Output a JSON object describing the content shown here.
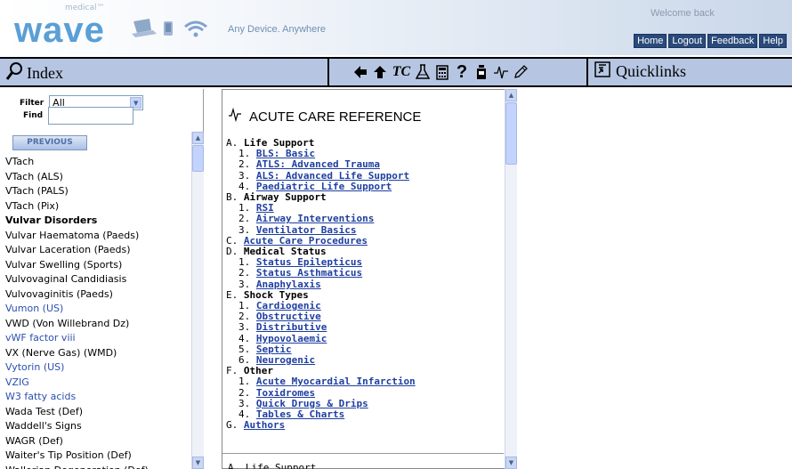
{
  "header": {
    "logo_small": "medical™",
    "logo": "wave",
    "tagline": "Any Device. Anywhere",
    "welcome": "Welcome back",
    "links": [
      "Home",
      "Logout",
      "Feedback",
      "Help"
    ]
  },
  "toolbar": {
    "index_label": "Index",
    "quicklinks_label": "Quicklinks",
    "tool_text": "TC",
    "icons": [
      "arrow-left-icon",
      "arrow-up-icon",
      "tc-icon",
      "flask-icon",
      "calculator-icon",
      "help-icon",
      "drug-icon",
      "ecg-icon",
      "pencil-icon"
    ]
  },
  "left": {
    "filter_label": "Filter",
    "filter_value": "All",
    "find_label": "Find",
    "find_value": "",
    "previous": "PREVIOUS",
    "items": [
      {
        "text": "VTach",
        "style": ""
      },
      {
        "text": "VTach (ALS)",
        "style": ""
      },
      {
        "text": "VTach (PALS)",
        "style": ""
      },
      {
        "text": "VTach (Pix)",
        "style": ""
      },
      {
        "text": "Vulvar Disorders",
        "style": "bold"
      },
      {
        "text": "Vulvar Haematoma (Paeds)",
        "style": ""
      },
      {
        "text": "Vulvar Laceration (Paeds)",
        "style": ""
      },
      {
        "text": "Vulvar Swelling (Sports)",
        "style": ""
      },
      {
        "text": "Vulvovaginal Candidiasis",
        "style": ""
      },
      {
        "text": "Vulvovaginitis (Paeds)",
        "style": ""
      },
      {
        "text": "Vumon (US)",
        "style": "blue"
      },
      {
        "text": "VWD (Von Willebrand Dz)",
        "style": ""
      },
      {
        "text": "vWF factor viii",
        "style": "blue"
      },
      {
        "text": "VX (Nerve Gas) (WMD)",
        "style": ""
      },
      {
        "text": "Vytorin (US)",
        "style": "blue"
      },
      {
        "text": "VZIG",
        "style": "blue"
      },
      {
        "text": "W3 fatty acids",
        "style": "blue"
      },
      {
        "text": "Wada Test (Def)",
        "style": ""
      },
      {
        "text": "Waddell's Signs",
        "style": ""
      },
      {
        "text": "WAGR (Def)",
        "style": ""
      },
      {
        "text": "Waiter's Tip Position (Def)",
        "style": ""
      },
      {
        "text": "Wallerian Degeneration (Def)",
        "style": ""
      }
    ]
  },
  "doc": {
    "title": "ACUTE CARE REFERENCE",
    "sections": [
      {
        "letter": "A.",
        "title": "Life Support",
        "link": false,
        "items": [
          "BLS: Basic",
          "ATLS: Advanced Trauma",
          "ALS: Advanced Life Support",
          "Paediatric Life Support"
        ]
      },
      {
        "letter": "B.",
        "title": "Airway Support",
        "link": false,
        "items": [
          "RSI",
          "Airway Interventions",
          "Ventilator Basics"
        ]
      },
      {
        "letter": "C.",
        "title": "Acute Care Procedures",
        "link": true,
        "items": []
      },
      {
        "letter": "D.",
        "title": "Medical Status",
        "link": false,
        "items": [
          "Status Epilepticus",
          "Status Asthmaticus",
          "Anaphylaxis"
        ]
      },
      {
        "letter": "E.",
        "title": "Shock Types",
        "link": false,
        "items": [
          "Cardiogenic",
          "Obstructive",
          "Distributive",
          "Hypovolaemic",
          "Septic",
          "Neurogenic"
        ]
      },
      {
        "letter": "F.",
        "title": "Other",
        "link": false,
        "items": [
          "Acute Myocardial Infarction",
          "Toxidromes",
          "Quick Drugs & Drips",
          "Tables & Charts"
        ]
      },
      {
        "letter": "G.",
        "title": "Authors",
        "link": true,
        "items": []
      }
    ],
    "next_heading": "A. Life Support"
  },
  "colors": {
    "toolbar_bg": "#b6c6e2",
    "link": "#1f3fa0",
    "header_button": "#2a4a7a"
  }
}
